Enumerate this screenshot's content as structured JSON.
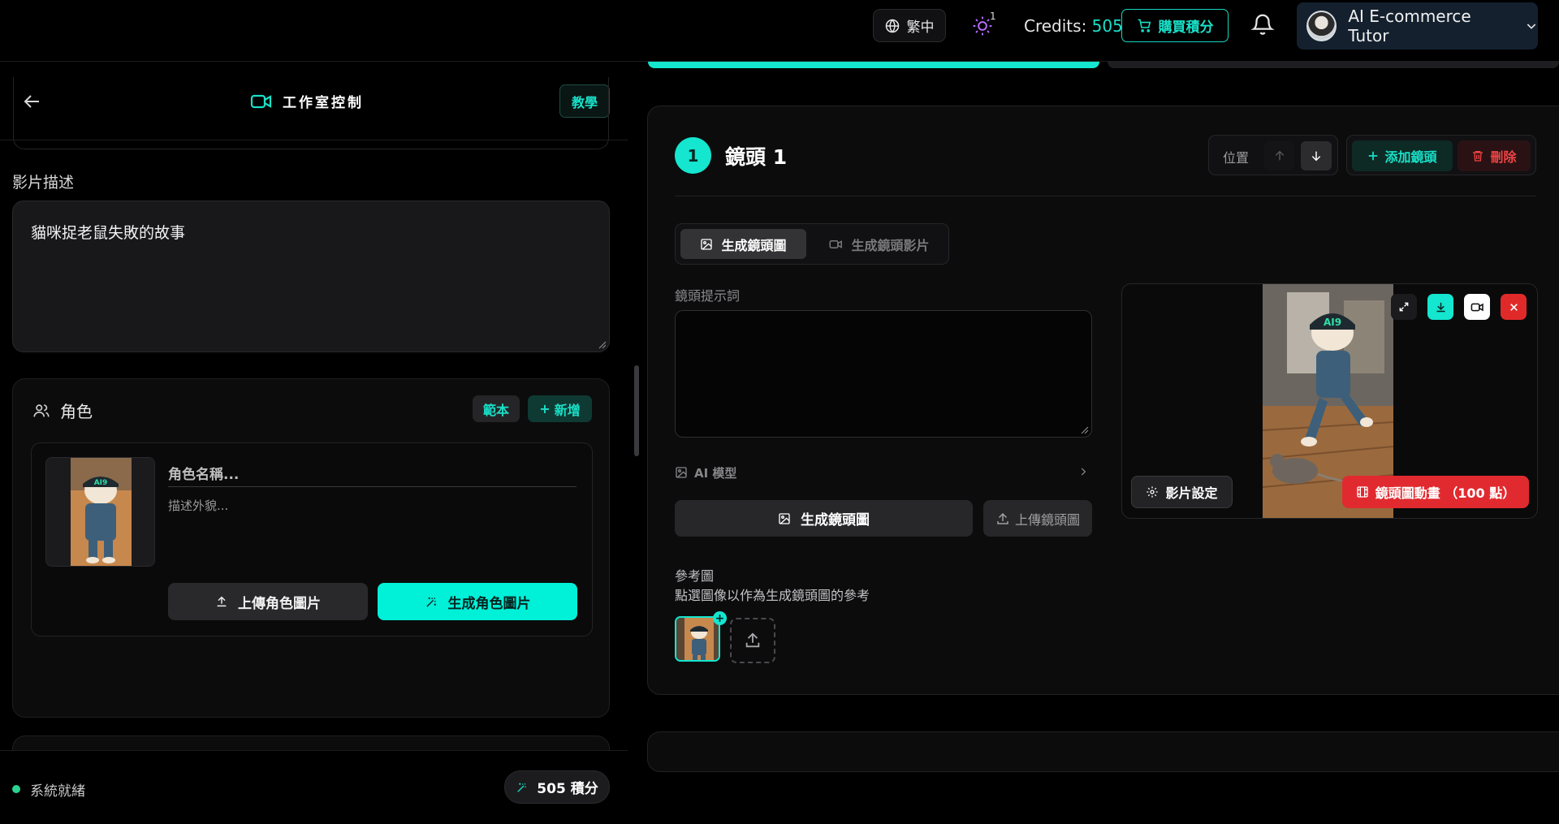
{
  "topbar": {
    "language": "繁中",
    "sun_badge": "1",
    "credits_label": "Credits:",
    "credits_value": "505",
    "buy_label": "購買積分",
    "user_name": "AI E-commerce Tutor"
  },
  "left": {
    "header_title": "工作室控制",
    "tutorial_label": "教學",
    "video_desc_label": "影片描述",
    "video_desc_value": "貓咪捉老鼠失敗的故事",
    "role": {
      "title": "角色",
      "sample_label": "範本",
      "add_label": "新增",
      "name_placeholder": "角色名稱...",
      "look_placeholder": "描述外貌...",
      "upload_label": "上傳角色圖片",
      "generate_label": "生成角色圖片"
    },
    "footer": {
      "status": "系統就緒",
      "points": "505 積分"
    }
  },
  "shot": {
    "number": "1",
    "title": "鏡頭 1",
    "position_label": "位置",
    "add_shot_label": "添加鏡頭",
    "delete_label": "刪除",
    "tabs": [
      "生成鏡頭圖",
      "生成鏡頭影片"
    ],
    "prompt_label": "鏡頭提示詞",
    "prompt_value": "",
    "model_label": "AI 模型",
    "generate_image_label": "生成鏡頭圖",
    "upload_image_label": "上傳鏡頭圖",
    "ref_label": "參考圖",
    "ref_hint": "點選圖像以作為生成鏡頭圖的參考",
    "video_settings_label": "影片設定",
    "animate_label": "鏡頭圖動畫 （100 點）"
  },
  "colors": {
    "accent": "#14e6cf",
    "danger": "#e12a2f",
    "background": "#000000",
    "card": "#0c0c0d"
  }
}
